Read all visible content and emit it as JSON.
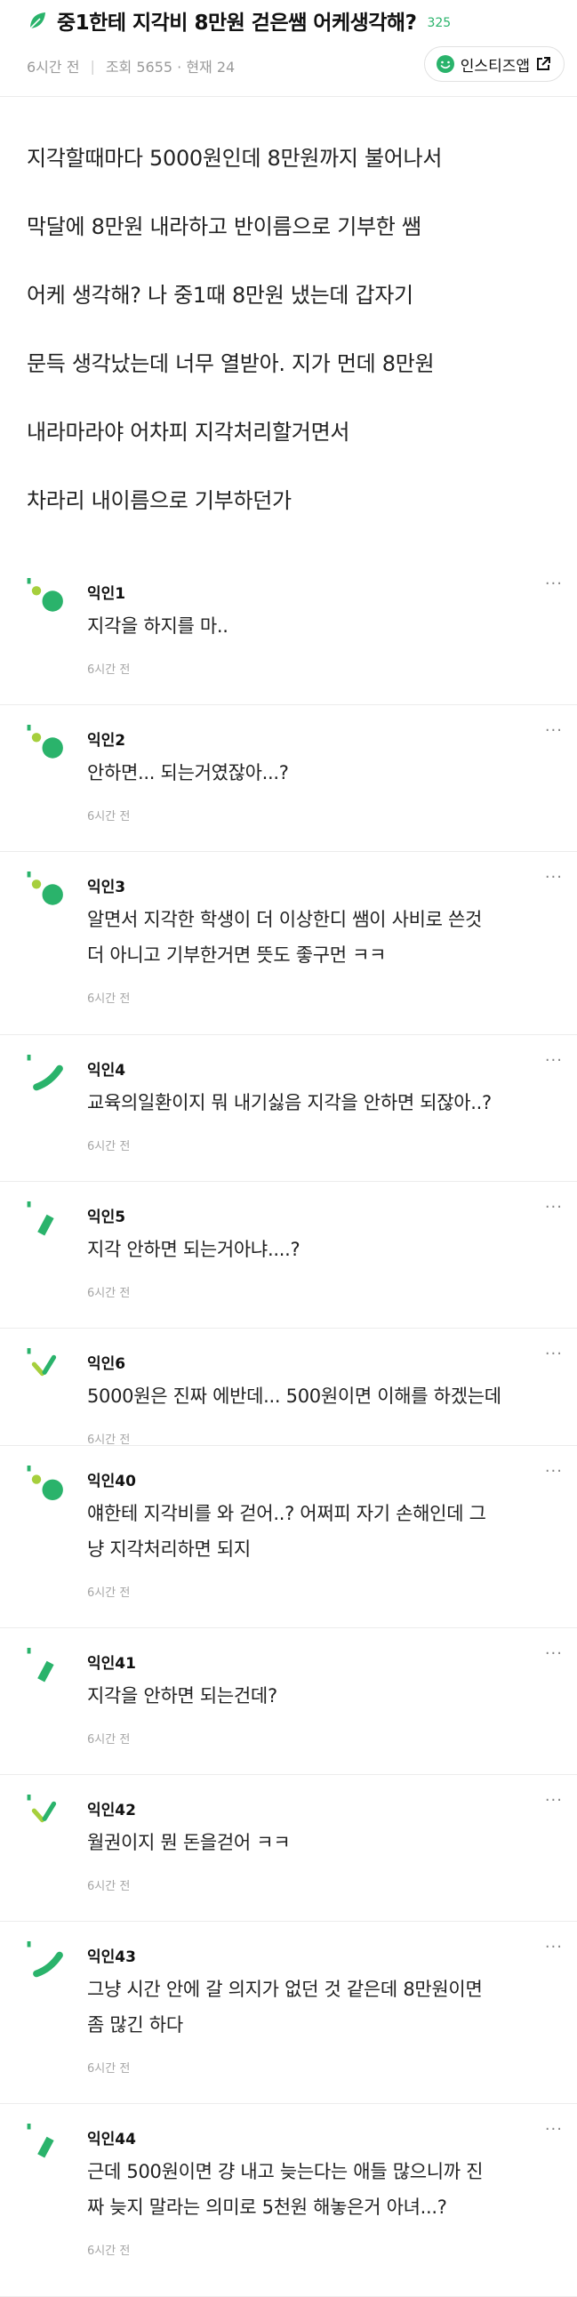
{
  "post": {
    "title": "중1한테 지각비 8만원 걷은쌤 어케생각해?",
    "count": "325",
    "time": "6시간 전",
    "views": "조회 5655 · 현재 24",
    "app_button": "인스티즈앱",
    "body_lines": [
      "지각할때마다 5000원인데 8만원까지 불어나서",
      "막달에 8만원 내라하고 반이름으로 기부한 쌤",
      "어케 생각해? 나 중1때 8만원 냈는데 갑자기",
      "문득 생각났는데 너무 열받아. 지가 먼데 8만원",
      "내라마라야 어차피 지각처리할거면서",
      "차라리 내이름으로 기부하던가"
    ]
  },
  "more_glyph": "···",
  "comments": [
    {
      "name": "익인1",
      "lines": [
        "지각을 하지를 마.."
      ],
      "time": "6시간 전"
    },
    {
      "name": "익인2",
      "lines": [
        "안하면... 되는거였잖아...?"
      ],
      "time": "6시간 전"
    },
    {
      "name": "익인3",
      "lines": [
        "알면서 지각한 학생이 더 이상한디 쌤이 사비로 쓴것",
        "더 아니고 기부한거면 뜻도 좋구먼 ㅋㅋ"
      ],
      "time": "6시간 전"
    },
    {
      "name": "익인4",
      "lines": [
        "교육의일환이지 뭐 내기싫음 지각을 안하면 되잖아..?"
      ],
      "time": "6시간 전"
    },
    {
      "name": "익인5",
      "lines": [
        "지각 안하면 되는거아냐....?"
      ],
      "time": "6시간 전"
    },
    {
      "name": "익인6",
      "lines": [
        "5000원은 진짜 에반데... 500원이면 이해를 하겠는데"
      ],
      "time": "6시간 전"
    },
    {
      "name": "익인40",
      "lines": [
        "얘한테 지각비를 와 걷어..? 어쩌피 자기 손해인데 그",
        "냥 지각처리하면 되지"
      ],
      "time": "6시간 전"
    },
    {
      "name": "익인41",
      "lines": [
        "지각을 안하면 되는건데?"
      ],
      "time": "6시간 전"
    },
    {
      "name": "익인42",
      "lines": [
        "월권이지 뭔 돈을걷어 ㅋㅋ"
      ],
      "time": "6시간 전"
    },
    {
      "name": "익인43",
      "lines": [
        "그냥 시간 안에 갈 의지가 없던 것 같은데 8만원이면",
        "좀 많긴 하다"
      ],
      "time": "6시간 전"
    },
    {
      "name": "익인44",
      "lines": [
        "근데 500원이면 걍 내고 늦는다는 애들 많으니까 진",
        "짜 늦지 말라는 의미로 5천원 해놓은거 아녀...?"
      ],
      "time": "6시간 전"
    }
  ]
}
